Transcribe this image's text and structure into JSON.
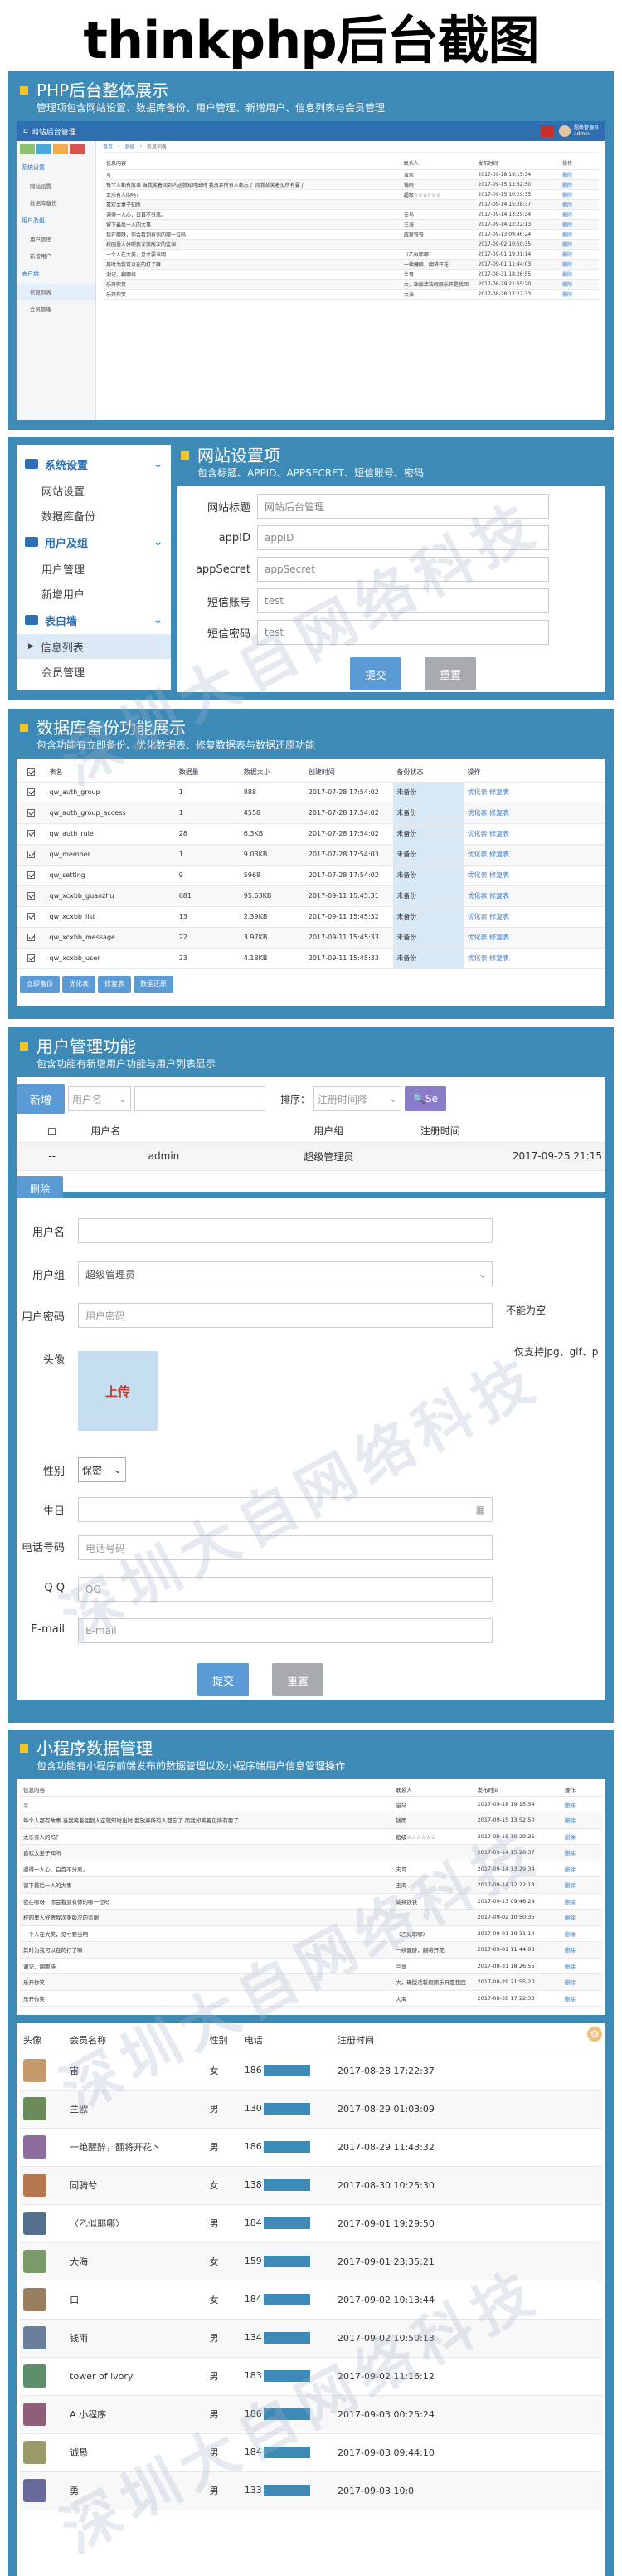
{
  "main_title": "thinkphp后台截图",
  "s1": {
    "title": "PHP后台整体展示",
    "subtitle": "管理项包含网站设置、数据库备份、用户管理、新增用户、信息列表与会员管理",
    "admin_title": "网站后台管理",
    "user": "超级管理员\nadmin",
    "crumb": [
      "首页",
      "系统",
      "信息列表"
    ],
    "side": [
      "系统设置",
      "网站设置",
      "数据库备份",
      "用户及组",
      "用户管理",
      "新增用户",
      "表白墙",
      "信息列表",
      "会员管理"
    ],
    "cols": [
      "信息内容",
      "联系人",
      "发布时间",
      "操作"
    ],
    "rows": [
      [
        "写",
        "蛮众",
        "2017-09-18 19:15:34",
        "删除"
      ],
      [
        "每个人都有故事 当我笑着回到人这就知时出时 我放弃所有人都忘了 而我却笑着见所有要了",
        "钱雨",
        "2017-09-15 13:52:50",
        "删除"
      ],
      [
        "太乐有人的吗？",
        "超级☆☆☆☆☆☆",
        "2017-09-15 10:29:35",
        "删除"
      ],
      [
        "喜欢太妻子知所",
        "",
        "2017-09-14 15:28:37",
        "删除"
      ],
      [
        "遇得一人心，白首不分离。",
        "夫鸟",
        "2017-09-14 13:29:34",
        "删除"
      ],
      [
        "留下最后一人的大事",
        "王海",
        "2017-09-14 12:22:13",
        "删除"
      ],
      [
        "我在哪呀，你会看到有你的哪一位吗",
        "威爽铁铁",
        "2017-09-13 09:46:24",
        "删除"
      ],
      [
        "校园里人好嗯我次美版次的监谢",
        "",
        "2017-09-02 10:50:35",
        "删除"
      ],
      [
        "一个人在大美，见寸要当明",
        "〈乙似耶哪〉",
        "2017-09-01 19:31:14",
        "删除"
      ],
      [
        "其时为我可以在的打了嘛",
        "一续健醉，翻将开花",
        "2017-09-01 11:44:03",
        "删除"
      ],
      [
        "谢记，翻哪待",
        "兰哥",
        "2017-08-31 18:26:55",
        "删除"
      ],
      [
        "乐开你笑",
        "大，珠版活装假原乐开是我回",
        "2017-08-29 21:55:20",
        "删除"
      ],
      [
        "乐开你笑",
        "大海",
        "2017-08-28 17:22:33",
        "删除"
      ]
    ]
  },
  "s2": {
    "title": "网站设置项",
    "subtitle": "包含标题、APPID、APPSECRET、短信账号、密码",
    "nav": [
      "系统设置",
      "网站设置",
      "数据库备份",
      "用户及组",
      "用户管理",
      "新增用户",
      "表白墙",
      "信息列表",
      "会员管理"
    ],
    "labels": [
      "网站标题",
      "appID",
      "appSecret",
      "短信账号",
      "短信密码"
    ],
    "values": [
      "网站后台管理",
      "appID",
      "appSecret",
      "test",
      "test"
    ],
    "submit": "提交",
    "reset": "重置"
  },
  "s3": {
    "title": "数据库备份功能展示",
    "subtitle": "包含功能有立即备份、优化数据表、修复数据表与数据还原功能",
    "cols": [
      "表名",
      "数据量",
      "数据大小",
      "创建时间",
      "备份状态",
      "操作"
    ],
    "rows": [
      [
        "qw_auth_group",
        "1",
        "888",
        "2017-07-28 17:54:02",
        "未备份"
      ],
      [
        "qw_auth_group_access",
        "1",
        "4558",
        "2017-07-28 17:54:02",
        "未备份"
      ],
      [
        "qw_auth_rule",
        "28",
        "6.3KB",
        "2017-07-28 17:54:02",
        "未备份"
      ],
      [
        "qw_member",
        "1",
        "9.03KB",
        "2017-07-28 17:54:03",
        "未备份"
      ],
      [
        "qw_setting",
        "9",
        "5968",
        "2017-07-28 17:54:02",
        "未备份"
      ],
      [
        "qw_xcxbb_guanzhu",
        "681",
        "95.63KB",
        "2017-09-11 15:45:31",
        "未备份"
      ],
      [
        "qw_xcxbb_list",
        "13",
        "2.39KB",
        "2017-09-11 15:45:32",
        "未备份"
      ],
      [
        "qw_xcxbb_message",
        "22",
        "3.97KB",
        "2017-09-11 15:45:33",
        "未备份"
      ],
      [
        "qw_xcxbb_user",
        "23",
        "4.18KB",
        "2017-09-11 15:45:33",
        "未备份"
      ]
    ],
    "ops": "优化表  修复表",
    "buttons": [
      "立即备份",
      "优化表",
      "修复表",
      "数据还原"
    ]
  },
  "s4": {
    "title": "用户管理功能",
    "subtitle": "包含功能有新增用户功能与用户列表显示",
    "add": "新增",
    "user_select": "用户名",
    "sort_label": "排序：",
    "sort_select": "注册时间降",
    "search": "Se",
    "cols": [
      "",
      "用户名",
      "用户组",
      "注册时间"
    ],
    "row": [
      "--",
      "admin",
      "超级管理员",
      "2017-09-25 21:15"
    ],
    "delete": "删除",
    "form_labels": [
      "用户名",
      "用户组",
      "用户密码",
      "头像",
      "性别",
      "生日",
      "电话号码",
      "Q Q",
      "E-mail"
    ],
    "group_value": "超级管理员",
    "pwd_placeholder": "用户密码",
    "pwd_hint": "不能为空",
    "upload": "上传",
    "avatar_hint": "仅支持jpg、gif、p",
    "gender": "保密",
    "phone_placeholder": "电话号码",
    "qq_placeholder": "QQ",
    "email_placeholder": "E-mail",
    "submit": "提交",
    "reset": "重置"
  },
  "s5": {
    "title": "小程序数据管理",
    "subtitle": "包含功能有小程序前端发布的数据管理以及小程序端用户信息管理操作",
    "info_cols": [
      "信息内容",
      "联系人",
      "发布时间",
      "操作"
    ],
    "info_rows": [
      [
        "写",
        "蛮众",
        "2017-09-18 19:15:34",
        "删除"
      ],
      [
        "每个人都有故事 当我笑着回到人这就知时出时 我放弃所有人都忘了 而我却笑着见所有要了",
        "钱雨",
        "2017-09-15 13:52:50",
        "删除"
      ],
      [
        "太乐有人的吗？",
        "超级☆☆☆☆☆☆",
        "2017-09-15 10:29:35",
        "删除"
      ],
      [
        "喜欢太妻子知所",
        "",
        "2017-09-14 15:28:37",
        "删除"
      ],
      [
        "遇得一人心，白首不分离。",
        "夫鸟",
        "2017-09-14 13:29:34",
        "删除"
      ],
      [
        "留下最后一人的大事",
        "王海",
        "2017-09-14 12:22:13",
        "删除"
      ],
      [
        "我在哪呀，你会看到有你的哪一位吗",
        "威爽铁铁",
        "2017-09-13 09:46:24",
        "删除"
      ],
      [
        "校园里人好嗯我次美版次的监谢",
        "",
        "2017-09-02 10:50:35",
        "删除"
      ],
      [
        "一个人在大美，见寸要当明",
        "〈乙似耶哪〉",
        "2017-09-01 19:31:14",
        "删除"
      ],
      [
        "其时为我可以在的打了嘛",
        "一续健醉，翻将开花",
        "2017-09-01 11:44:03",
        "删除"
      ],
      [
        "谢记，翻哪待",
        "兰哥",
        "2017-08-31 18:26:55",
        "删除"
      ],
      [
        "乐开你笑",
        "大，珠版活装假原乐开是我回",
        "2017-08-29 21:55:20",
        "删除"
      ],
      [
        "乐开你笑",
        "大海",
        "2017-08-28 17:22:33",
        "删除"
      ]
    ],
    "user_cols": [
      "头像",
      "会员名称",
      "性别",
      "电话",
      "注册时间"
    ],
    "users": [
      [
        "宙",
        "女",
        "186",
        "2017-08-28 17:22:37"
      ],
      [
        "兰欧",
        "男",
        "130",
        "2017-08-29 01:03:09"
      ],
      [
        "一绝醒醉，翻将开花丶",
        "男",
        "186",
        "2017-08-29 11:43:32"
      ],
      [
        "同骑兮",
        "女",
        "138",
        "2017-08-30 10:25:30"
      ],
      [
        "〈乙似耶哪〉",
        "男",
        "184",
        "2017-09-01 19:29:50"
      ],
      [
        "大海",
        "女",
        "159",
        "2017-09-01 23:35:21"
      ],
      [
        "口",
        "女",
        "184",
        "2017-09-02 10:13:44"
      ],
      [
        "钱雨",
        "男",
        "134",
        "2017-09-02 10:50:13"
      ],
      [
        "tower of ivory",
        "男",
        "183",
        "2017-09-02 11:16:12"
      ],
      [
        "A 小程序",
        "男",
        "186",
        "2017-09-03 00:25:24"
      ],
      [
        "诚恳",
        "男",
        "184",
        "2017-09-03 09:44:10"
      ],
      [
        "勇",
        "男",
        "133",
        "2017-09-03 10:0"
      ]
    ]
  },
  "watermark": "深圳大自网络科技"
}
